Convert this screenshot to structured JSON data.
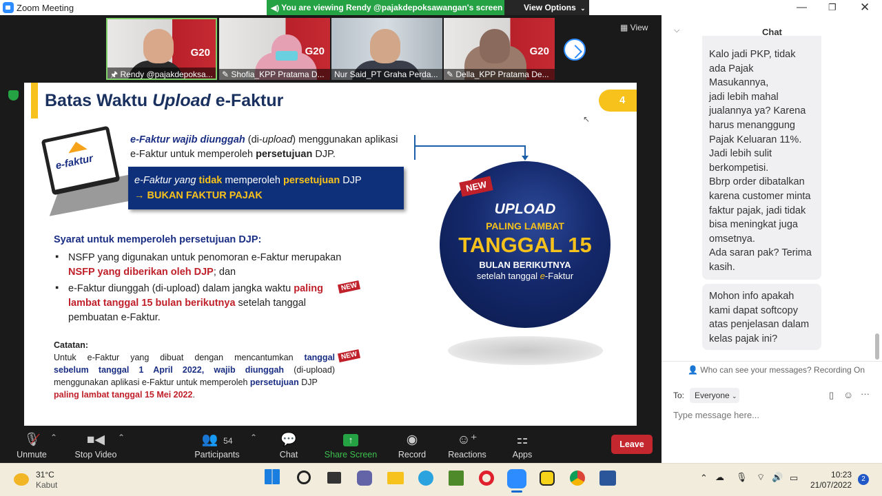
{
  "window": {
    "title": "Zoom Meeting"
  },
  "banner": {
    "text": "You are viewing Rendy @pajakdepoksawangan's screen",
    "view_options": "View Options"
  },
  "gallery": {
    "view_label": "View",
    "participants": [
      {
        "name": "Rendy @pajakdepoksa..."
      },
      {
        "name": "Shofia_KPP Pratama D..."
      },
      {
        "name": "Nur Said_PT Graha Perda..."
      },
      {
        "name": "Della_KPP Pratama De..."
      }
    ],
    "g20_text": "G20"
  },
  "slide": {
    "title_part1": "Batas Waktu ",
    "title_italic": "Upload",
    "title_part2": " e-Faktur",
    "page_number": "4",
    "laptop_label": "e-faktur",
    "p1_bold": "e-Faktur wajib diunggah",
    "p1_a": " (di-",
    "p1_italic": "upload",
    "p1_b": ") menggunakan aplikasi",
    "p1_line2_a": "e-Faktur untuk memperoleh ",
    "p1_line2_bold": "persetujuan",
    "p1_line2_b": " DJP.",
    "box_line1_a": "e-Faktur yang ",
    "box_line1_y1": "tidak",
    "box_line1_b": " memperoleh ",
    "box_line1_y2": "persetujuan",
    "box_line1_c": " DJP",
    "box_line2": "→ BUKAN FAKTUR PAJAK",
    "req_heading": "Syarat untuk memperoleh persetujuan DJP:",
    "bullet1_a": "NSFP yang digunakan untuk penomoran e-Faktur merupakan",
    "bullet1_red": "NSFP yang diberikan oleh DJP",
    "bullet1_b": "; dan",
    "bullet2_a": "e-Faktur diunggah (di-upload) dalam jangka waktu ",
    "bullet2_red1": "paling",
    "bullet2_red2": "lambat tanggal 15 bulan berikutnya",
    "bullet2_b": " setelah tanggal",
    "bullet2_c": "pembuatan e-Faktur.",
    "note_heading": "Catatan:",
    "note_l1_a": "Untuk e-Faktur yang dibuat dengan mencantumkan ",
    "note_l1_navy": "tanggal",
    "note_l2_navy": "sebelum tanggal 1 April 2022, wajib diunggah",
    "note_l2_b": " (di-upload)",
    "note_l3_a": "menggunakan aplikasi e-Faktur untuk memperoleh ",
    "note_l3_navy": "persetujuan",
    "note_l3_b": " DJP",
    "note_l4_red": "paling lambat tanggal 15 Mei 2022",
    "note_l4_b": ".",
    "new_tag": "NEW",
    "ball_upload": "UPLOAD",
    "ball_paling": "PALING LAMBAT",
    "ball_tanggal": "TANGGAL 15",
    "ball_bulan": "BULAN BERIKUTNYA",
    "ball_setelah_a": "setelah tanggal ",
    "ball_setelah_e": "e",
    "ball_setelah_b": "-Faktur"
  },
  "toolbar": {
    "unmute": "Unmute",
    "stop_video": "Stop Video",
    "participants": "Participants",
    "participants_count": "54",
    "chat": "Chat",
    "share_screen": "Share Screen",
    "record": "Record",
    "reactions": "Reactions",
    "apps": "Apps",
    "leave": "Leave"
  },
  "chat": {
    "header": "Chat",
    "message1_lines": [
      "Kalo jadi PKP, tidak",
      "ada Pajak Masukannya,",
      "jadi lebih mahal",
      "jualannya ya? Karena",
      "harus menanggung",
      "Pajak Keluaran 11%.",
      "Jadi lebih sulit",
      "berkompetisi.",
      "Bbrp order dibatalkan",
      "karena customer minta",
      "faktur pajak, jadi tidak",
      "bisa meningkat juga",
      "omsetnya.",
      "Ada saran pak? Terima",
      "kasih."
    ],
    "message2_lines": [
      "Mohon info apakah",
      "kami dapat softcopy",
      "atas penjelasan dalam",
      "kelas pajak ini?"
    ],
    "who_can_see": "Who can see your messages? Recording On",
    "to_label": "To:",
    "recipient": "Everyone",
    "input_placeholder": "Type message here..."
  },
  "taskbar": {
    "temperature": "31°C",
    "weather": "Kabut",
    "time": "10:23",
    "date": "21/07/2022",
    "notification_count": "2"
  },
  "colors": {
    "zoom_blue": "#2d8cff",
    "share_green": "#25a244",
    "leave_red": "#c4282e",
    "slide_navy": "#1a2e84",
    "slide_yellow": "#f7c21b",
    "slide_red": "#c0202a"
  }
}
